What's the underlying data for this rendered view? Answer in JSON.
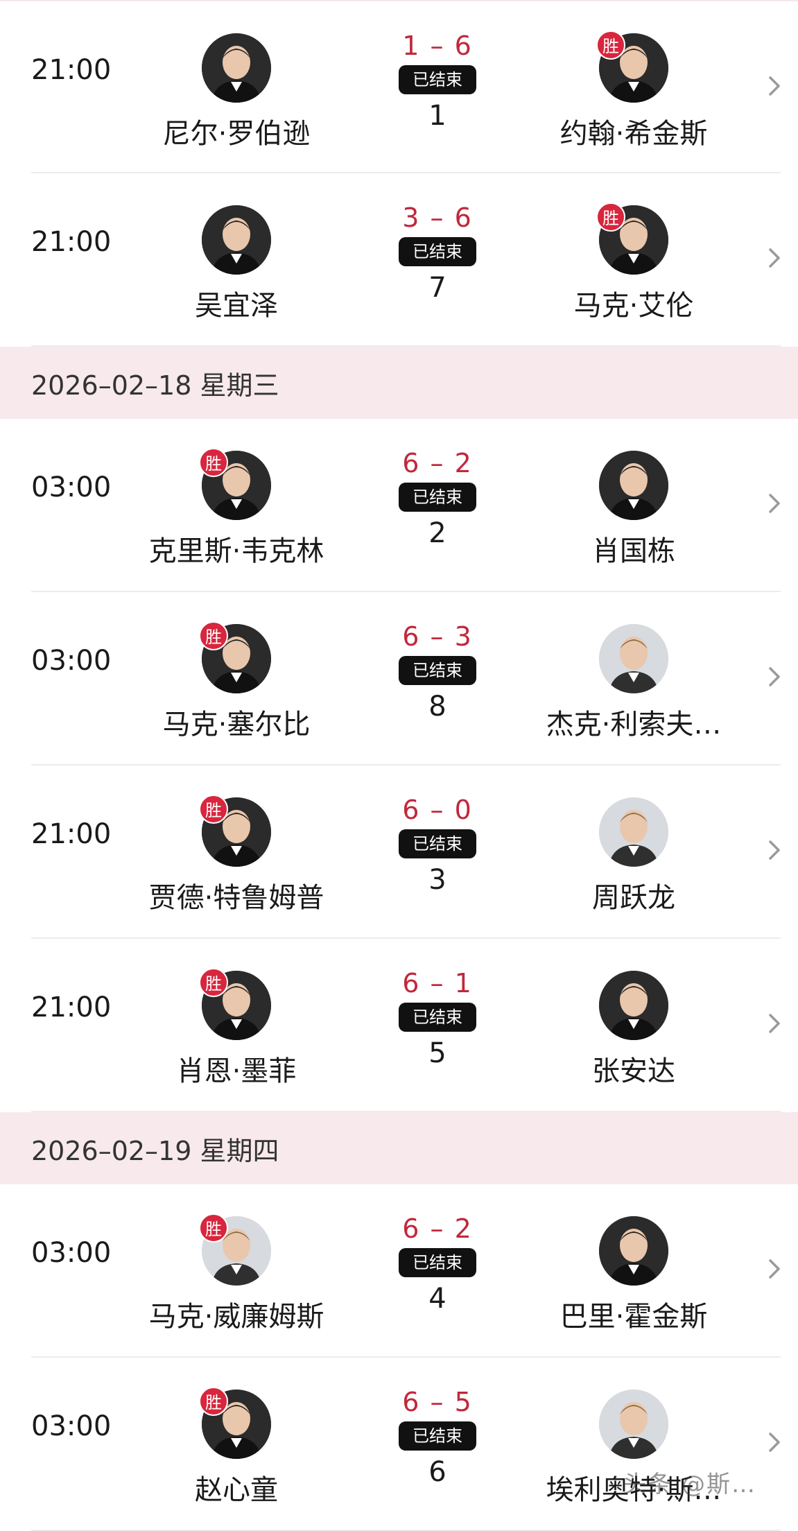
{
  "colors": {
    "winner_badge": "#d7263d",
    "score": "#c0283c",
    "date_header_bg": "#f7e9ec",
    "status_pill": "#111111"
  },
  "win_label": "胜",
  "status_label": "已结束",
  "sections": [
    {
      "date": "",
      "matches": [
        {
          "time": "21:00",
          "home": "尼尔·罗伯逊",
          "away": "约翰·希金斯",
          "score": "1 – 6",
          "match_no": "1",
          "winner": "away"
        },
        {
          "time": "21:00",
          "home": "吴宜泽",
          "away": "马克·艾伦",
          "score": "3 – 6",
          "match_no": "7",
          "winner": "away"
        }
      ]
    },
    {
      "date": "2026–02–18 星期三",
      "matches": [
        {
          "time": "03:00",
          "home": "克里斯·韦克林",
          "away": "肖国栋",
          "score": "6 – 2",
          "match_no": "2",
          "winner": "home"
        },
        {
          "time": "03:00",
          "home": "马克·塞尔比",
          "away": "杰克·利索夫…",
          "score": "6 – 3",
          "match_no": "8",
          "winner": "home"
        },
        {
          "time": "21:00",
          "home": "贾德·特鲁姆普",
          "away": "周跃龙",
          "score": "6 – 0",
          "match_no": "3",
          "winner": "home"
        },
        {
          "time": "21:00",
          "home": "肖恩·墨菲",
          "away": "张安达",
          "score": "6 – 1",
          "match_no": "5",
          "winner": "home"
        }
      ]
    },
    {
      "date": "2026–02–19 星期四",
      "matches": [
        {
          "time": "03:00",
          "home": "马克·威廉姆斯",
          "away": "巴里·霍金斯",
          "score": "6 – 2",
          "match_no": "4",
          "winner": "home"
        },
        {
          "time": "03:00",
          "home": "赵心童",
          "away": "埃利奥特·斯…",
          "score": "6 – 5",
          "match_no": "6",
          "winner": "home"
        }
      ]
    }
  ],
  "watermark": "头条 @斯…"
}
